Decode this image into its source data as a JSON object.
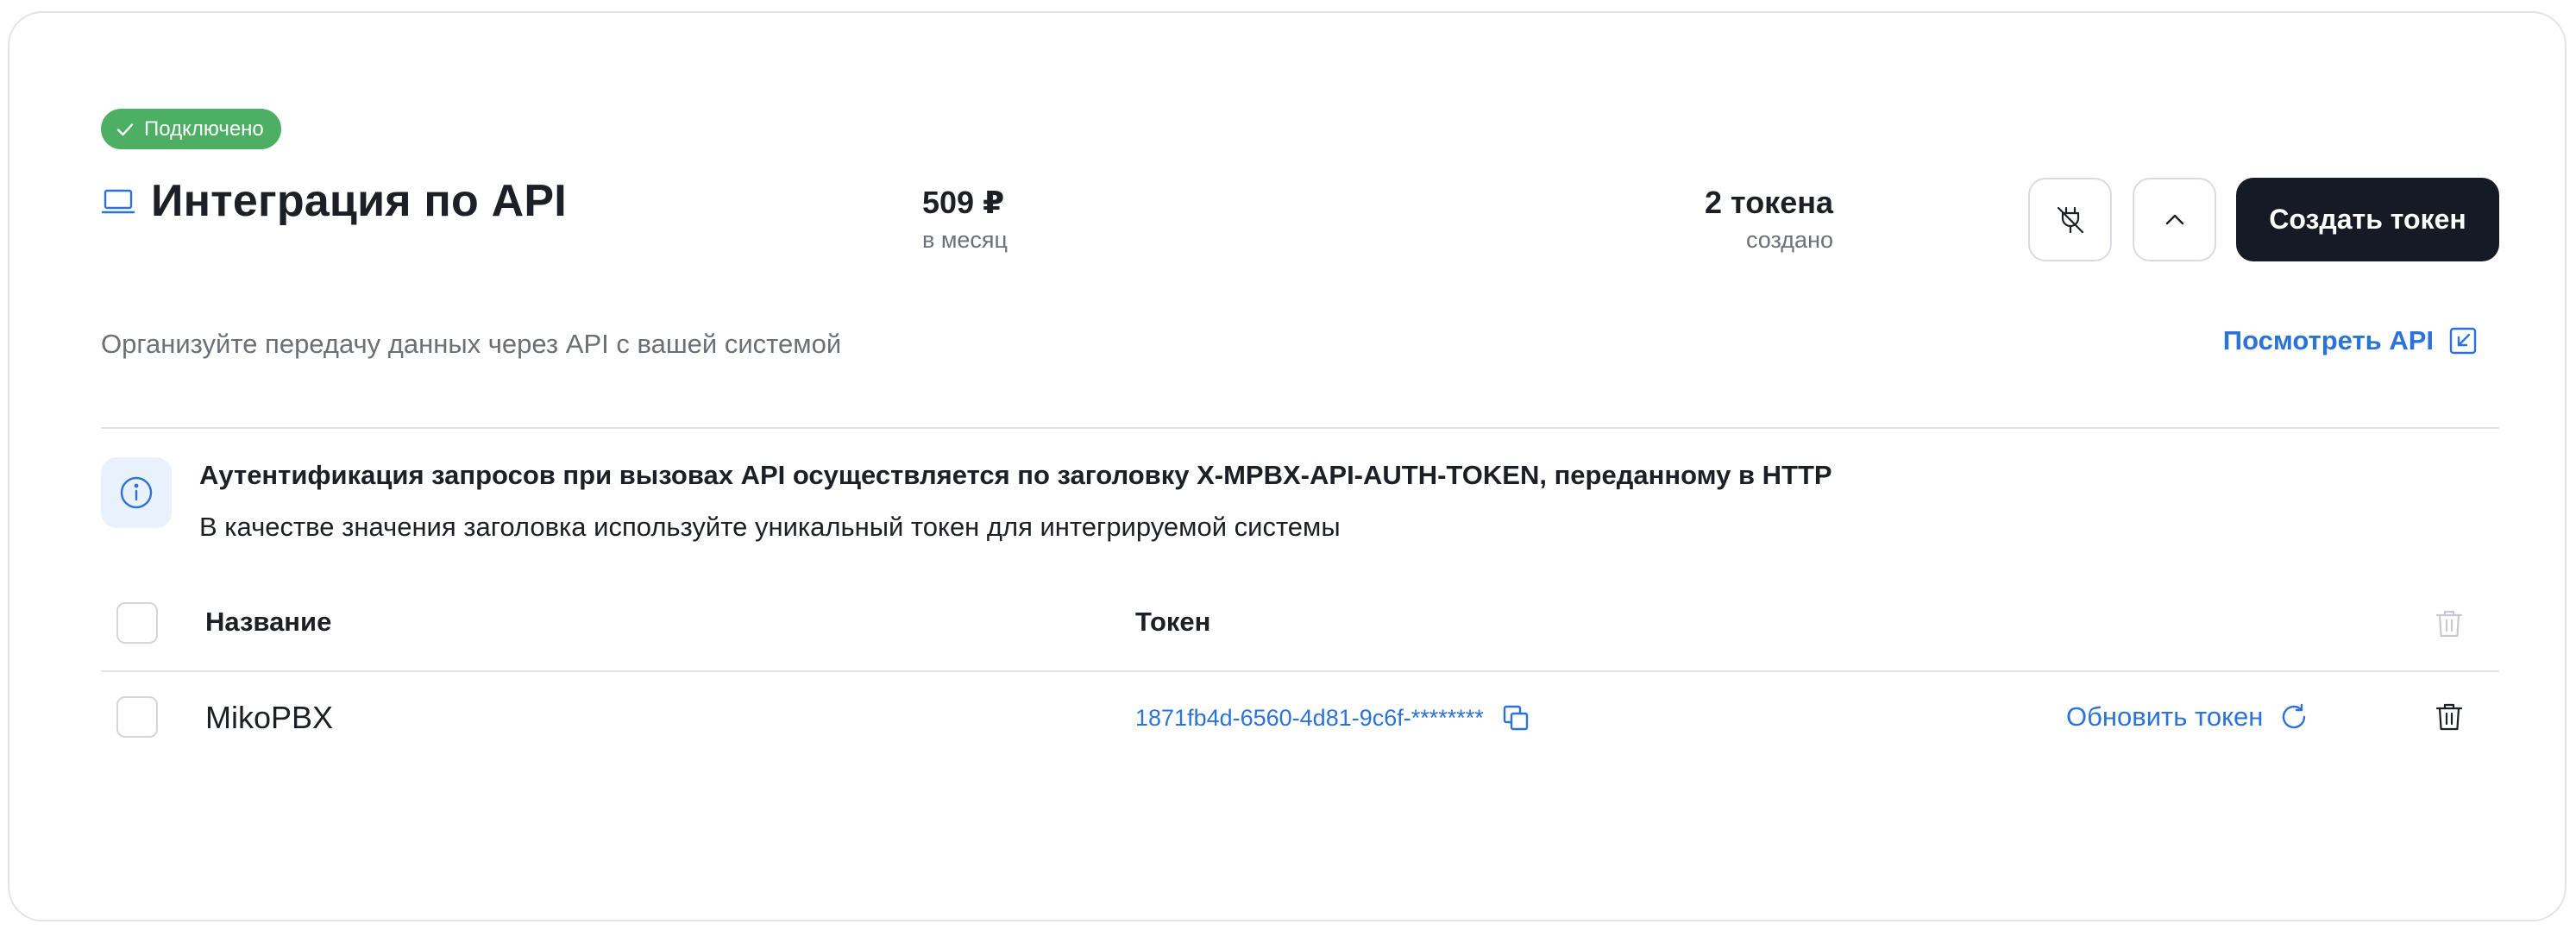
{
  "status_badge": "Подключено",
  "title": "Интеграция по API",
  "price": {
    "value": "509 ₽",
    "caption": "в месяц"
  },
  "tokens": {
    "value": "2 токена",
    "caption": "создано"
  },
  "actions": {
    "create_token": "Создать токен"
  },
  "description": "Организуйте передачу данных через API с вашей системой",
  "api_link": "Посмотреть API",
  "info": {
    "title": "Аутентификация запросов при вызовах API осуществляется по заголовку X-MPBX-API-AUTH-TOKEN, переданному в HTTP",
    "subtitle": "В качестве значения заголовка используйте уникальный токен для интегрируемой системы"
  },
  "table": {
    "headers": {
      "name": "Название",
      "token": "Токен"
    },
    "rows": [
      {
        "name": "MikoPBX",
        "token": "1871fb4d-6560-4d81-9c6f-********",
        "refresh_label": "Обновить токен"
      }
    ]
  },
  "colors": {
    "accent": "#2b73d9",
    "success": "#4caf63",
    "primary_button": "#161a25"
  },
  "icons": {
    "badge": "check-icon",
    "title": "laptop-icon",
    "unplug": "unplug-icon",
    "collapse": "chevron-up-icon",
    "external_link": "external-link-icon",
    "info": "info-icon",
    "copy": "copy-icon",
    "refresh": "refresh-icon",
    "delete": "trash-icon"
  }
}
